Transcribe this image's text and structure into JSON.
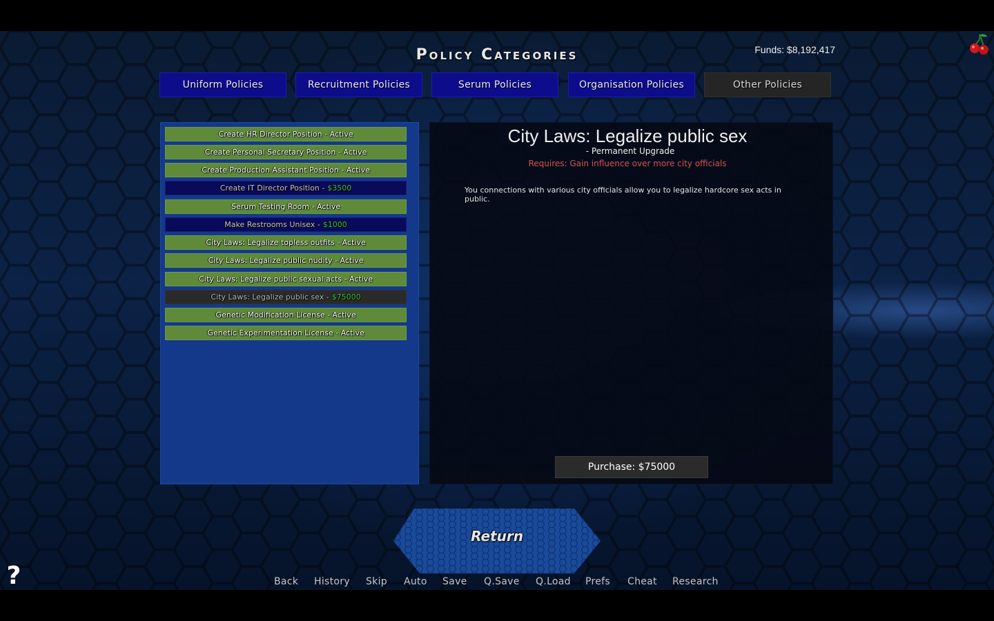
{
  "header": {
    "title": "Policy Categories",
    "funds": "Funds: $8,192,417"
  },
  "tabs": [
    {
      "label": "Uniform Policies",
      "active": false
    },
    {
      "label": "Recruitment Policies",
      "active": false
    },
    {
      "label": "Serum Policies",
      "active": false
    },
    {
      "label": "Organisation Policies",
      "active": false
    },
    {
      "label": "Other Policies",
      "active": true
    }
  ],
  "policies": [
    {
      "label": "Create HR Director Position - Active",
      "price": "",
      "state": "active"
    },
    {
      "label": "Create Personal Secretary Position - Active",
      "price": "",
      "state": "active"
    },
    {
      "label": "Create Production Assistant Position - Active",
      "price": "",
      "state": "active"
    },
    {
      "label": "Create IT Director Position -",
      "price": "$3500",
      "state": "buy"
    },
    {
      "label": "Serum Testing Room - Active",
      "price": "",
      "state": "active"
    },
    {
      "label": "Make Restrooms Unisex -",
      "price": "$1000",
      "state": "buy"
    },
    {
      "label": "City Laws: Legalize topless outfits - Active",
      "price": "",
      "state": "active"
    },
    {
      "label": "City Laws: Legalize public nudity - Active",
      "price": "",
      "state": "active"
    },
    {
      "label": "City Laws: Legalize public sexual acts - Active",
      "price": "",
      "state": "active"
    },
    {
      "label": "City Laws: Legalize public sex -",
      "price": "$75000",
      "state": "selected"
    },
    {
      "label": "Genetic Modification License - Active",
      "price": "",
      "state": "active"
    },
    {
      "label": "Genetic Experimentation License - Active",
      "price": "",
      "state": "active"
    }
  ],
  "detail": {
    "title": "City Laws: Legalize public sex",
    "subtitle": "- Permanent Upgrade",
    "requirement": "Requires: Gain influence over more city officials",
    "description": "You connections with various city officials allow you to legalize hardcore sex acts in public.",
    "purchase_label": "Purchase: $75000"
  },
  "return_label": "Return",
  "help_label": "?",
  "quick_menu": [
    "Back",
    "History",
    "Skip",
    "Auto",
    "Save",
    "Q.Save",
    "Q.Load",
    "Prefs",
    "Cheat",
    "Research"
  ],
  "colors": {
    "active_policy": "#5e8a3a",
    "buyable_policy": "#0a0a5a",
    "selected_policy": "#2a2a2a",
    "price_green": "#3cc23c",
    "requirement_red": "#d55252",
    "tab_blue": "#0d0d8c",
    "list_panel_blue": "#15398a"
  },
  "icons": {
    "cherry": "cherry-icon",
    "help": "question-mark-icon"
  }
}
